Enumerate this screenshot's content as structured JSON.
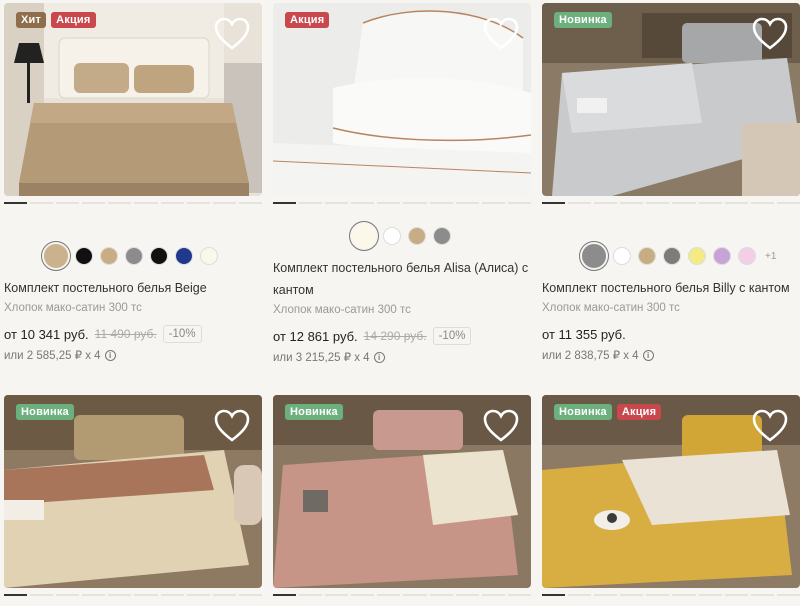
{
  "products": [
    {
      "badges": [
        "Хит",
        "Акция"
      ],
      "swatches": [
        "#c9b28c",
        "#111111",
        "#c8ad84",
        "#8c8c8c",
        "#111111",
        "#1f3a8a",
        "#fbf8ea"
      ],
      "selected_swatch": 0,
      "more": "",
      "title": "Комплект постельного белья Beige",
      "material": "Хлопок мако-сатин 300 тс",
      "price": "от 10 341 руб.",
      "old_price": "11 490 руб.",
      "discount": "-10%",
      "installment": "или  2 585,25 ₽ x 4"
    },
    {
      "badges": [
        "Акция"
      ],
      "swatches": [
        "#fbf8ea",
        "#ffffff",
        "#c8ad84",
        "#8c8c8c"
      ],
      "selected_swatch": 0,
      "more": "",
      "title": "Комплект постельного белья Alisa (Алиса) с кантом",
      "material": "Хлопок мако-сатин 300 тс",
      "price": "от 12 861 руб.",
      "old_price": "14 290 руб.",
      "discount": "-10%",
      "installment": "или  3 215,25 ₽ x 4"
    },
    {
      "badges": [
        "Новинка"
      ],
      "swatches": [
        "#8c8c8c",
        "#ffffff",
        "#c8ad84",
        "#7c7c7c",
        "#f3ec85",
        "#c7a3d6",
        "#f4cde6"
      ],
      "selected_swatch": 0,
      "more": "+1",
      "title": "Комплект постельного белья Billy с кантом",
      "material": "Хлопок мако-сатин 300 тс",
      "price": "от 11 355 руб.",
      "old_price": "",
      "discount": "",
      "installment": "или  2 838,75 ₽ x 4"
    },
    {
      "badges": [
        "Новинка"
      ]
    },
    {
      "badges": [
        "Новинка"
      ]
    },
    {
      "badges": [
        "Новинка",
        "Акция"
      ]
    }
  ]
}
